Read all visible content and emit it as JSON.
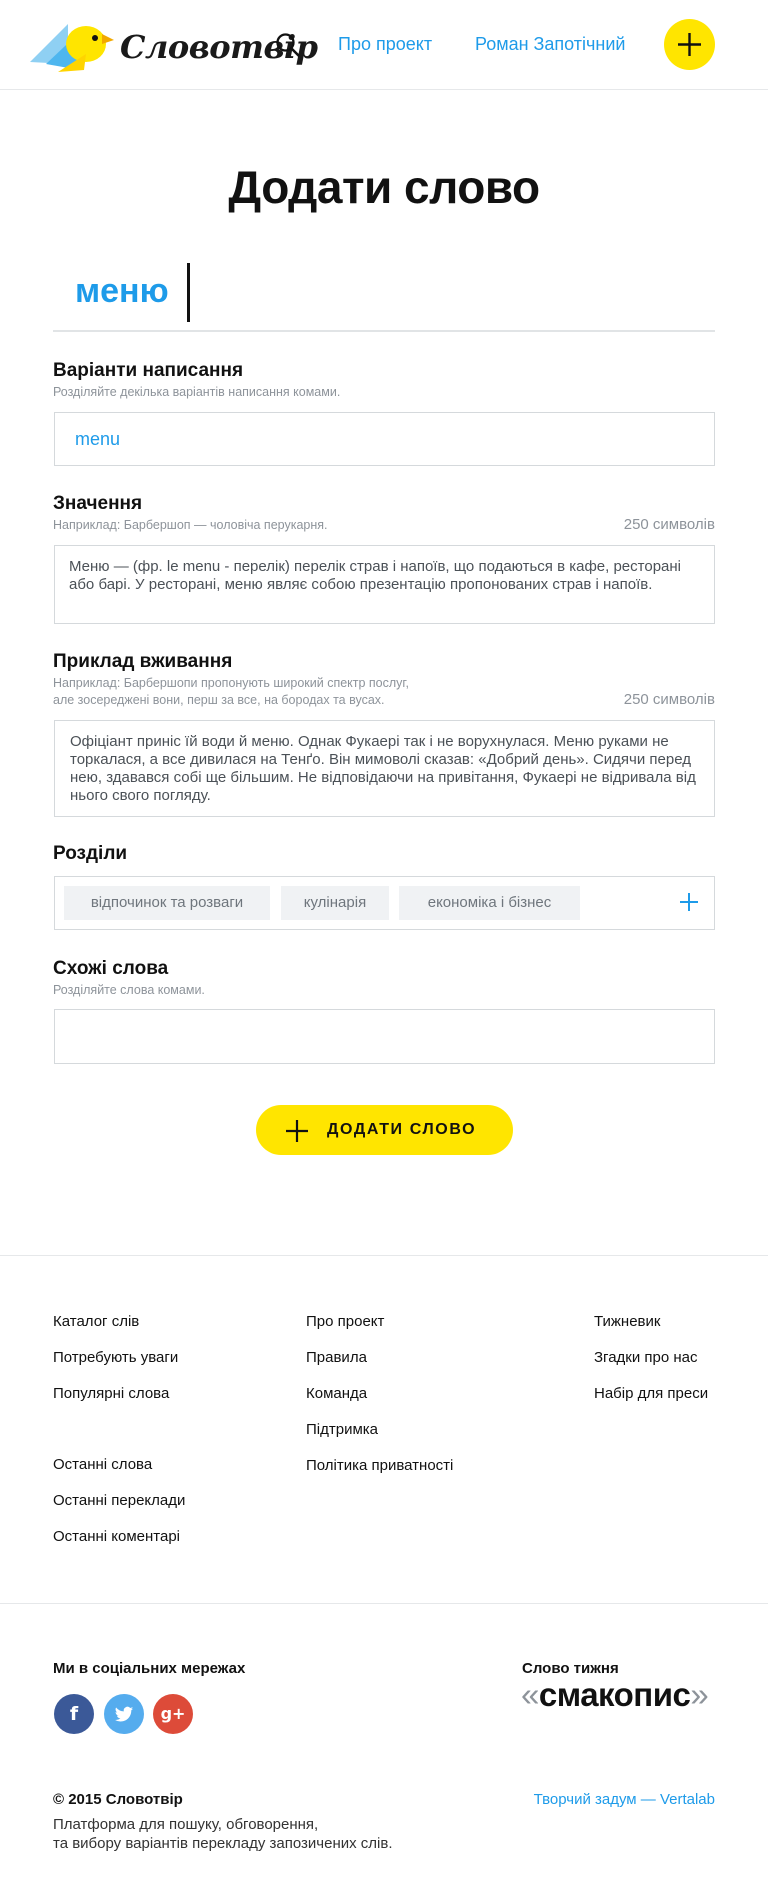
{
  "header": {
    "logo_text": "Словотвір",
    "nav": {
      "about": "Про проект",
      "user": "Роман Запотічний"
    },
    "icons": {
      "search": "search-icon",
      "add": "plus-icon"
    },
    "accent": "#ffe500",
    "link_color": "#1e9be9"
  },
  "main": {
    "title": "Додати слово",
    "word": "меню",
    "spelling": {
      "label": "Варіанти написання",
      "hint": "Розділяйте декілька варіантів написання комами.",
      "value": "menu"
    },
    "meaning": {
      "label": "Значення",
      "hint": "Наприклад: Барбершоп — чоловіча перукарня.",
      "counter": "250 символів",
      "value": "Меню — (фр. le menu - перелік) перелік страв і напоїв, що подаються в кафе, ресторані або барі. У ресторані, меню являє собою презентацію пропонованих страв і напоїв."
    },
    "example": {
      "label": "Приклад вживання",
      "hint_line1": "Наприклад: Барбершопи пропонують широкий спектр послуг,",
      "hint_line2": "але зосереджені вони, перш за все, на бородах та вусах.",
      "counter": "250 символів",
      "value": "Офіціант приніс їй води й меню. Однак Фукаері так і не ворухнулася. Меню руками не торкалася, а все дивилася на Тенґо. Він мимоволі сказав: «Добрий день». Сидячи перед нею, здавався собі ще більшим. Не відповідаючи на привітання, Фукаері не відривала від нього свого погляду."
    },
    "sections": {
      "label": "Розділи",
      "tags": [
        "відпочинок та розваги",
        "кулінарія",
        "економіка і бізнес"
      ]
    },
    "similar": {
      "label": "Схожі слова",
      "hint": "Розділяйте слова комами.",
      "value": ""
    },
    "submit_label": "ДОДАТИ СЛОВО"
  },
  "footer": {
    "col1": [
      "Каталог слів",
      "Потребують уваги",
      "Популярні слова",
      "Останні слова",
      "Останні переклади",
      "Останні коментарі"
    ],
    "col2": [
      "Про проект",
      "Правила",
      "Команда",
      "Підтримка",
      "Політика приватності"
    ],
    "col3": [
      "Тижневик",
      "Згадки про нас",
      "Набір для преси"
    ],
    "social_title": "Ми в соціальних мережах",
    "social": [
      {
        "name": "facebook",
        "glyph": "f",
        "color": "#3b5998"
      },
      {
        "name": "twitter",
        "glyph": "t",
        "color": "#55acee"
      },
      {
        "name": "google-plus",
        "glyph": "g+",
        "color": "#dd4b39"
      }
    ],
    "word_of_week_title": "Слово тижня",
    "word_of_week": "смакопис",
    "copyright": "© 2015 Словотвір",
    "description_line1": "Платформа для пошуку, обговорення,",
    "description_line2": "та вибору варіантів перекладу запозичених слів.",
    "credit": "Творчий задум — Vertalab"
  }
}
